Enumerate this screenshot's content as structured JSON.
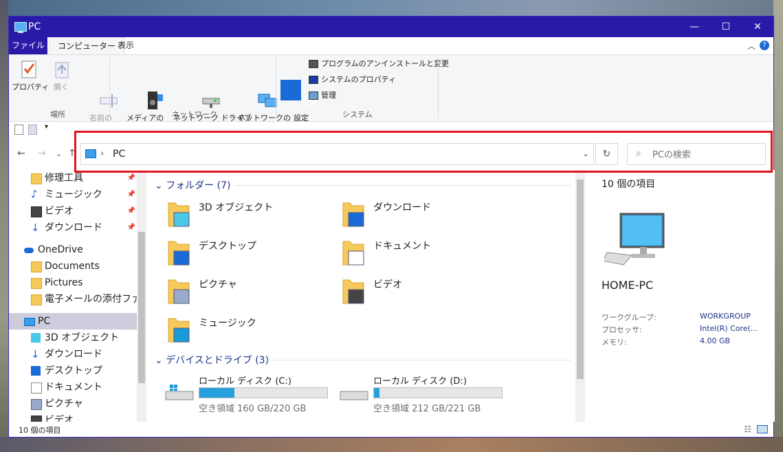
{
  "window": {
    "title": "PC",
    "minimize": "—",
    "maximize": "☐",
    "close": "✕"
  },
  "menu": {
    "file": "ファイル",
    "tabs": [
      "コンピューター",
      "表示"
    ],
    "collapse": "︿",
    "help": "?"
  },
  "ribbon": {
    "location_group": {
      "label": "場所",
      "buttons": [
        "プロパティ",
        "開く",
        "名前の\n変更"
      ]
    },
    "network_group": {
      "label": "ネットワーク",
      "buttons": [
        "メディアの\n接続と切断 ▾",
        "ネットワーク ドライブ\nの割り当て ▾",
        "ネットワークの\n場所の追加"
      ]
    },
    "system_group": {
      "label": "システム",
      "settings_button": "設定\nを開く",
      "items": [
        "プログラムのアンインストールと変更",
        "システムのプロパティ",
        "管理"
      ]
    }
  },
  "address": {
    "separator": "›",
    "path": "PC",
    "dropdown": "⌄",
    "refresh": "↻"
  },
  "search": {
    "placeholder": "PCの検索",
    "icon": "⌕"
  },
  "nav_buttons": {
    "back": "←",
    "forward": "→",
    "recent": "⌄",
    "up": "↑"
  },
  "nav_pane": {
    "items": [
      {
        "label": "修理工具",
        "icon": "folder-icon",
        "pinned": true
      },
      {
        "label": "ミュージック",
        "icon": "music-icon",
        "pinned": true
      },
      {
        "label": "ビデオ",
        "icon": "video-icon",
        "pinned": true
      },
      {
        "label": "ダウンロード",
        "icon": "download-icon",
        "pinned": true
      },
      {
        "label": "OneDrive",
        "icon": "cloud-icon"
      },
      {
        "label": "Documents",
        "icon": "folder-icon"
      },
      {
        "label": "Pictures",
        "icon": "folder-icon"
      },
      {
        "label": "電子メールの添付ファイ",
        "icon": "folder-icon"
      },
      {
        "label": "PC",
        "icon": "computer-icon",
        "selected": true
      },
      {
        "label": "3D オブジェクト",
        "icon": "cube-icon"
      },
      {
        "label": "ダウンロード",
        "icon": "download-icon"
      },
      {
        "label": "デスクトップ",
        "icon": "desktop-icon"
      },
      {
        "label": "ドキュメント",
        "icon": "document-icon"
      },
      {
        "label": "ピクチャ",
        "icon": "picture-icon"
      },
      {
        "label": "ビデオ",
        "icon": "video-icon"
      }
    ]
  },
  "content": {
    "folders_header": "フォルダー (7)",
    "folders": [
      "3D オブジェクト",
      "ダウンロード",
      "デスクトップ",
      "ドキュメント",
      "ピクチャ",
      "ビデオ",
      "ミュージック"
    ],
    "drives_header": "デバイスとドライブ (3)",
    "drives": [
      {
        "name": "ローカル ディスク (C:)",
        "free": "空き領域 160 GB/220 GB",
        "used_fraction": 0.273
      },
      {
        "name": "ローカル ディスク (D:)",
        "free": "空き領域 212 GB/221 GB",
        "used_fraction": 0.041
      }
    ]
  },
  "details": {
    "count": "10 個の項目",
    "computer_name": "HOME-PC",
    "fields": [
      {
        "key": "ワークグループ:",
        "value": "WORKGROUP"
      },
      {
        "key": "プロセッサ:",
        "value": "Intel(R) Core(..."
      },
      {
        "key": "メモリ:",
        "value": "4.00 GB"
      }
    ]
  },
  "status": {
    "count": "10 個の項目"
  },
  "colors": {
    "titlebar": "#2a1aa8",
    "highlight": "#e0141e",
    "drive_fill": "#26a0da",
    "folder": "#f5c95a"
  }
}
